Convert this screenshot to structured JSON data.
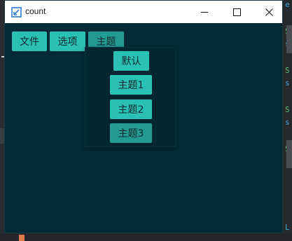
{
  "window": {
    "title": "count",
    "minimize": "minimize-icon",
    "maximize": "maximize-icon",
    "close": "close-icon"
  },
  "menubar": {
    "items": [
      {
        "label": "文件"
      },
      {
        "label": "选项"
      },
      {
        "label": "主题",
        "active": true
      }
    ]
  },
  "theme_menu": {
    "items": [
      {
        "label": "默认"
      },
      {
        "label": "主题1"
      },
      {
        "label": "主题2"
      },
      {
        "label": "主题3",
        "selected": true
      }
    ]
  },
  "colors": {
    "window_bg": "#032a36",
    "button_bg": "#2bc0b4",
    "button_active_bg": "#239a92",
    "titlebar_bg": "#ffffff"
  }
}
